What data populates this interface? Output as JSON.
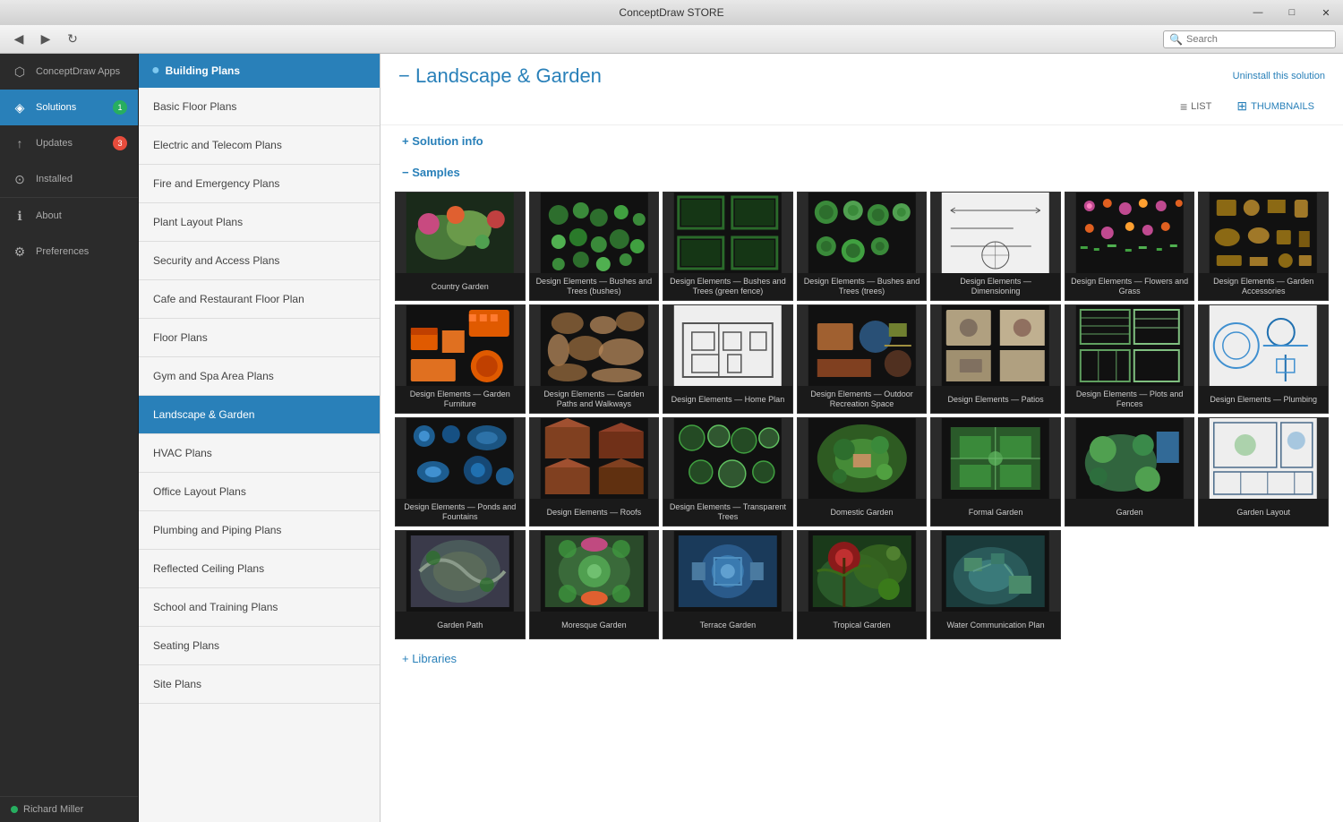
{
  "titleBar": {
    "title": "ConceptDraw STORE",
    "minimize": "—",
    "maximize": "□",
    "close": "✕"
  },
  "toolbar": {
    "back": "◀",
    "forward": "▶",
    "refresh": "↻",
    "searchPlaceholder": "Search"
  },
  "sidebar": {
    "items": [
      {
        "id": "conceptdraw-apps",
        "label": "ConceptDraw Apps",
        "icon": "⬡",
        "badge": null
      },
      {
        "id": "solutions",
        "label": "Solutions",
        "icon": "◈",
        "badge": "1",
        "badgeColor": "green",
        "active": true
      },
      {
        "id": "updates",
        "label": "Updates",
        "icon": "↑",
        "badge": "3",
        "badgeColor": "red"
      },
      {
        "id": "installed",
        "label": "Installed",
        "icon": "⊙",
        "badge": null
      },
      {
        "id": "about",
        "label": "About",
        "icon": "ℹ",
        "badge": null
      },
      {
        "id": "preferences",
        "label": "Preferences",
        "icon": "⚙",
        "badge": null
      }
    ],
    "user": {
      "name": "Richard Miller",
      "statusColor": "#27ae60"
    }
  },
  "navPanel": {
    "sectionHeader": "Building Plans",
    "items": [
      {
        "id": "basic-floor-plans",
        "label": "Basic Floor Plans"
      },
      {
        "id": "electric-telecom",
        "label": "Electric and Telecom Plans"
      },
      {
        "id": "fire-emergency",
        "label": "Fire and Emergency Plans"
      },
      {
        "id": "plant-layout",
        "label": "Plant Layout Plans"
      },
      {
        "id": "security-access",
        "label": "Security and Access Plans"
      },
      {
        "id": "cafe-restaurant",
        "label": "Cafe and Restaurant Floor Plan"
      },
      {
        "id": "floor-plans",
        "label": "Floor Plans"
      },
      {
        "id": "gym-spa",
        "label": "Gym and Spa Area Plans"
      },
      {
        "id": "landscape-garden",
        "label": "Landscape & Garden",
        "active": true
      },
      {
        "id": "hvac-plans",
        "label": "HVAC Plans"
      },
      {
        "id": "office-layout",
        "label": "Office Layout Plans"
      },
      {
        "id": "plumbing-piping",
        "label": "Plumbing and Piping Plans"
      },
      {
        "id": "reflected-ceiling",
        "label": "Reflected Ceiling Plans"
      },
      {
        "id": "school-training",
        "label": "School and Training Plans"
      },
      {
        "id": "seating-plans",
        "label": "Seating Plans"
      },
      {
        "id": "site-plans",
        "label": "Site Plans"
      }
    ]
  },
  "content": {
    "title": "Landscape & Garden",
    "solutionInfoLabel": "+ Solution info",
    "samplesLabel": "− Samples",
    "librariesLabel": "+ Libraries",
    "viewList": "LIST",
    "viewThumbnails": "THUMBNAILS",
    "uninstallLabel": "Uninstall this solution",
    "thumbnails": [
      {
        "id": "country-garden",
        "label": "Country Garden",
        "color": "#4a7a3a",
        "type": "garden"
      },
      {
        "id": "de-bushes-trees-bushes",
        "label": "Design Elements — Bushes and Trees (bushes)",
        "color": "#2d6e2d",
        "type": "circles"
      },
      {
        "id": "de-bushes-trees-green",
        "label": "Design Elements — Bushes and Trees (green fence)",
        "color": "#1a5c1a",
        "type": "grid-green"
      },
      {
        "id": "de-bushes-trees-trees",
        "label": "Design Elements — Bushes and Trees (trees)",
        "color": "#3a8a3a",
        "type": "circles-dark"
      },
      {
        "id": "de-dimensioning",
        "label": "Design Elements — Dimensioning",
        "color": "#888",
        "type": "lines"
      },
      {
        "id": "de-flowers-grass",
        "label": "Design Elements — Flowers and Grass",
        "color": "#c04a90",
        "type": "flowers"
      },
      {
        "id": "de-garden-accessories",
        "label": "Design Elements — Garden Accessories",
        "color": "#8B6914",
        "type": "accessories"
      },
      {
        "id": "de-garden-furniture",
        "label": "Design Elements — Garden Furniture",
        "color": "#e05a00",
        "type": "furniture"
      },
      {
        "id": "de-garden-paths",
        "label": "Design Elements — Garden Paths and Walkways",
        "color": "#a07040",
        "type": "paths"
      },
      {
        "id": "de-home-plan",
        "label": "Design Elements — Home Plan",
        "color": "#777",
        "type": "home"
      },
      {
        "id": "de-outdoor-recreation",
        "label": "Design Elements — Outdoor Recreation Space",
        "color": "#a06030",
        "type": "recreation"
      },
      {
        "id": "de-patios",
        "label": "Design Elements — Patios",
        "color": "#b0a080",
        "type": "patios"
      },
      {
        "id": "de-plots-fences",
        "label": "Design Elements — Plots and Fences",
        "color": "#60a060",
        "type": "fences"
      },
      {
        "id": "de-plumbing",
        "label": "Design Elements — Plumbing",
        "color": "#4090d0",
        "type": "plumbing"
      },
      {
        "id": "de-ponds-fountains",
        "label": "Design Elements — Ponds and Fountains",
        "color": "#2070b0",
        "type": "ponds"
      },
      {
        "id": "de-roofs",
        "label": "Design Elements — Roofs",
        "color": "#804020",
        "type": "roofs"
      },
      {
        "id": "de-transparent-trees",
        "label": "Design Elements — Transparent Trees",
        "color": "#40a040",
        "type": "transparent"
      },
      {
        "id": "domestic-garden",
        "label": "Domestic Garden",
        "color": "#5a9a3a",
        "type": "domestic"
      },
      {
        "id": "formal-garden",
        "label": "Formal Garden",
        "color": "#6a8a5a",
        "type": "formal"
      },
      {
        "id": "garden",
        "label": "Garden",
        "color": "#3a7a4a",
        "type": "garden2"
      },
      {
        "id": "garden-layout",
        "label": "Garden Layout",
        "color": "#4a6a8a",
        "type": "layout"
      },
      {
        "id": "garden-path",
        "label": "Garden Path",
        "color": "#5a5a6a",
        "type": "path"
      },
      {
        "id": "moresque-garden",
        "label": "Moresque Garden",
        "color": "#4a8a4a",
        "type": "moresque"
      },
      {
        "id": "terrace-garden",
        "label": "Terrace Garden",
        "color": "#5090a0",
        "type": "terrace"
      },
      {
        "id": "tropical-garden",
        "label": "Tropical Garden",
        "color": "#6a8020",
        "type": "tropical"
      },
      {
        "id": "water-communication",
        "label": "Water Communication Plan",
        "color": "#4a7a6a",
        "type": "water"
      }
    ]
  }
}
